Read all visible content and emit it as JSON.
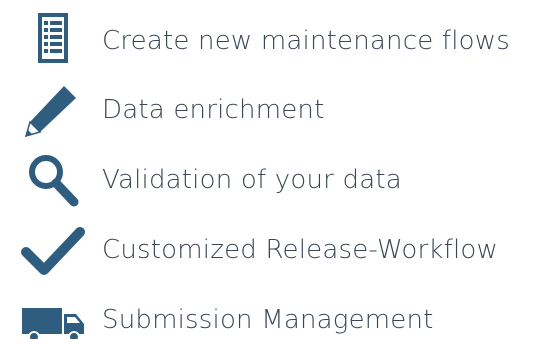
{
  "features": {
    "accent_color": "#2f5d80",
    "items": [
      {
        "label": "Create new maintenance flows",
        "icon": "checklist-icon"
      },
      {
        "label": "Data enrichment",
        "icon": "pencil-icon"
      },
      {
        "label": "Validation of your data",
        "icon": "magnifier-icon"
      },
      {
        "label": "Customized Release-Workflow",
        "icon": "checkmark-icon"
      },
      {
        "label": "Submission Management",
        "icon": "truck-icon"
      }
    ]
  }
}
